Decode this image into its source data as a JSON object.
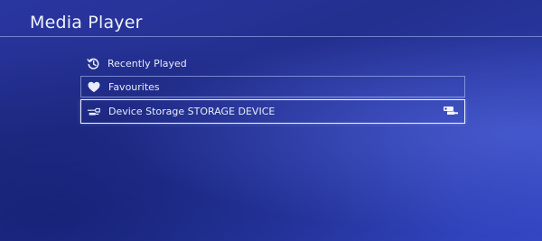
{
  "header": {
    "title": "Media Player"
  },
  "menu": {
    "items": [
      {
        "label": "Recently Played",
        "icon": "history-icon"
      },
      {
        "label": "Favourites",
        "icon": "heart-icon"
      },
      {
        "label": "Device Storage STORAGE DEVICE",
        "icon": "usb-icon",
        "trailing_icon": "usb-icon",
        "selected": true
      }
    ]
  },
  "colors": {
    "background": "#2a36a0",
    "text": "#e8ecfa",
    "selected_border": "#eef2ff"
  }
}
